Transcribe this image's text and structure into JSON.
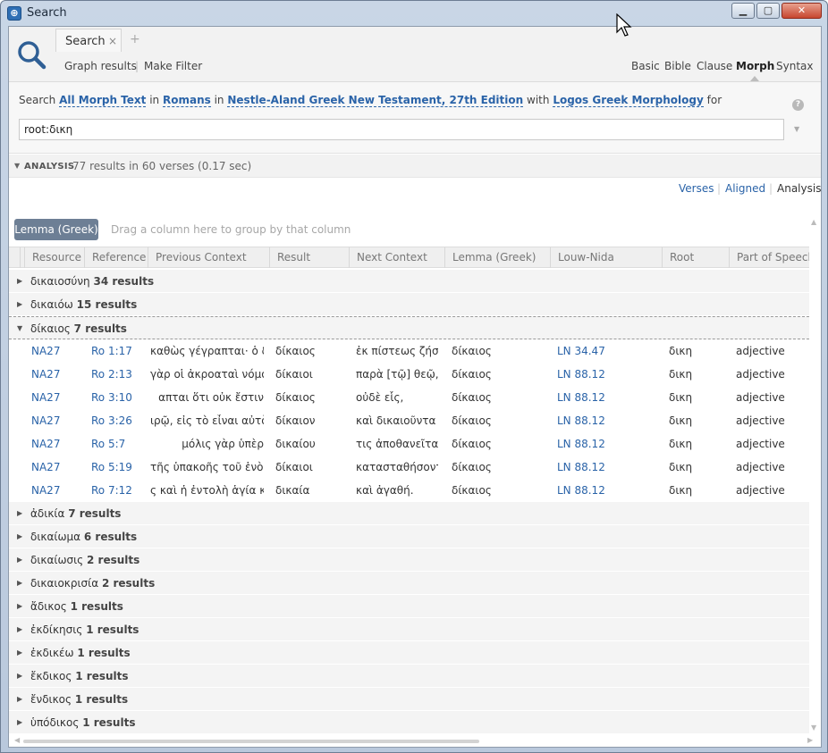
{
  "window": {
    "title": "Search"
  },
  "tabs": [
    {
      "label": "Search",
      "close": "×"
    }
  ],
  "tab_add": "+",
  "subtoolbar": {
    "graph_results": "Graph results",
    "make_filter": "Make Filter",
    "sep": "|"
  },
  "modes": [
    "Basic",
    "Bible",
    "Clause",
    "Morph",
    "Syntax"
  ],
  "active_mode": "Morph",
  "query": {
    "prefix": "Search",
    "scope": "All Morph Text",
    "in1": "in",
    "passage": "Romans",
    "in2": "in",
    "resource": "Nestle-Aland Greek New Testament, 27th Edition",
    "with": "with",
    "morphology": "Logos Greek Morphology",
    "for": "for",
    "input_value": "root:δικη",
    "help": "?"
  },
  "analysis": {
    "label": "ANALYSIS",
    "summary": "77 results in 60 verses (0.17 sec)"
  },
  "views": [
    "Verses",
    "Aligned",
    "Analysis"
  ],
  "active_view": "Analysis",
  "group_chip": "Lemma (Greek)",
  "group_hint": "Drag a column here to group by that column",
  "columns": [
    "Resource",
    "Reference",
    "Previous Context",
    "Result",
    "Next Context",
    "Lemma (Greek)",
    "Louw-Nida",
    "Root",
    "Part of Speech"
  ],
  "groups_before": [
    {
      "lemma": "δικαιοσύνη",
      "count": "34 results"
    },
    {
      "lemma": "δικαιόω",
      "count": "15 results"
    }
  ],
  "expanded_group": {
    "lemma": "δίκαιος",
    "count": "7 results"
  },
  "rows": [
    {
      "resource": "NA27",
      "reference": "Ro 1:17",
      "prev": "καθὼς γέγραπται· ὁ δὲ",
      "result": "δίκαιος",
      "next": "ἐκ πίστεως ζήσεται.",
      "lemma": "δίκαιος",
      "louw_nida": "LN 34.47",
      "root": "δικη",
      "pos": "adjective"
    },
    {
      "resource": "NA27",
      "reference": "Ro 2:13",
      "prev": "γὰρ οἱ ἀκροαταὶ νόμου",
      "result": "δίκαιοι",
      "next": "παρὰ [τῷ] θεῷ, ἀλλʼ",
      "lemma": "δίκαιος",
      "louw_nida": "LN 88.12",
      "root": "δικη",
      "pos": "adjective"
    },
    {
      "resource": "NA27",
      "reference": "Ro 3:10",
      "prev": "απται ὅτι      οὐκ ἔστιν",
      "result": "δίκαιος",
      "next": "οὐδὲ εἷς,",
      "lemma": "δίκαιος",
      "louw_nida": "LN 88.12",
      "root": "δικη",
      "pos": "adjective"
    },
    {
      "resource": "NA27",
      "reference": "Ro 3:26",
      "prev": "ιρῷ, εἰς τὸ εἶναι αὐτὸν",
      "result": "δίκαιον",
      "next": "καὶ δικαιοῦντα τὸν",
      "lemma": "δίκαιος",
      "louw_nida": "LN 88.12",
      "root": "δικη",
      "pos": "adjective"
    },
    {
      "resource": "NA27",
      "reference": "Ro 5:7",
      "prev": "μόλις γὰρ ὑπὲρ",
      "result": "δικαίου",
      "next": "τις ἀποθανεῖται·",
      "lemma": "δίκαιος",
      "louw_nida": "LN 88.12",
      "root": "δικη",
      "pos": "adjective"
    },
    {
      "resource": "NA27",
      "reference": "Ro 5:19",
      "prev": "τῆς ὑπακοῆς τοῦ ἑνὸς",
      "result": "δίκαιοι",
      "next": "κατασταθήσονται",
      "lemma": "δίκαιος",
      "louw_nida": "LN 88.12",
      "root": "δικη",
      "pos": "adjective"
    },
    {
      "resource": "NA27",
      "reference": "Ro 7:12",
      "prev": "ς καὶ ἡ ἐντολὴ ἁγία καὶ",
      "result": "δικαία",
      "next": "καὶ ἀγαθή.",
      "lemma": "δίκαιος",
      "louw_nida": "LN 88.12",
      "root": "δικη",
      "pos": "adjective"
    }
  ],
  "groups_after": [
    {
      "lemma": "ἀδικία",
      "count": "7 results"
    },
    {
      "lemma": "δικαίωμα",
      "count": "6 results"
    },
    {
      "lemma": "δικαίωσις",
      "count": "2 results"
    },
    {
      "lemma": "δικαιοκρισία",
      "count": "2 results"
    },
    {
      "lemma": "ἄδικος",
      "count": "1 results"
    },
    {
      "lemma": "ἐκδίκησις",
      "count": "1 results"
    },
    {
      "lemma": "ἐκδικέω",
      "count": "1 results"
    },
    {
      "lemma": "ἔκδικος",
      "count": "1 results"
    },
    {
      "lemma": "ἔνδικος",
      "count": "1 results"
    },
    {
      "lemma": "ὑπόδικος",
      "count": "1 results"
    }
  ],
  "colors": {
    "link": "#2a63a8",
    "chip": "#6d7f95",
    "close_button": "#c7462f"
  }
}
